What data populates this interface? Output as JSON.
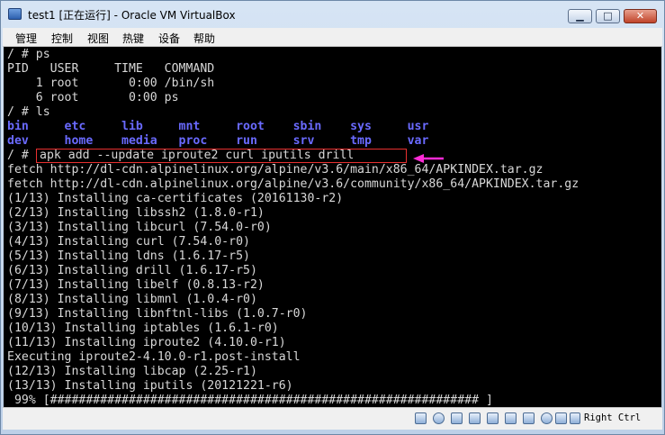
{
  "window": {
    "title": "test1 [正在运行] - Oracle VM VirtualBox"
  },
  "titlebar_buttons": {
    "minimize": "▁",
    "maximize": "□",
    "close": "✕"
  },
  "menu": [
    "管理",
    "控制",
    "视图",
    "热键",
    "设备",
    "帮助"
  ],
  "terminal": {
    "lines": [
      "/ # ps",
      "PID   USER     TIME   COMMAND",
      "    1 root       0:00 /bin/sh",
      "    6 root       0:00 ps",
      "/ # ls",
      "",
      "",
      "/ # ",
      "fetch http://dl-cdn.alpinelinux.org/alpine/v3.6/main/x86_64/APKINDEX.tar.gz",
      "fetch http://dl-cdn.alpinelinux.org/alpine/v3.6/community/x86_64/APKINDEX.tar.gz",
      "(1/13) Installing ca-certificates (20161130-r2)",
      "(2/13) Installing libssh2 (1.8.0-r1)",
      "(3/13) Installing libcurl (7.54.0-r0)",
      "(4/13) Installing curl (7.54.0-r0)",
      "(5/13) Installing ldns (1.6.17-r5)",
      "(6/13) Installing drill (1.6.17-r5)",
      "(7/13) Installing libelf (0.8.13-r2)",
      "(8/13) Installing libmnl (1.0.4-r0)",
      "(9/13) Installing libnftnl-libs (1.0.7-r0)",
      "(10/13) Installing iptables (1.6.1-r0)",
      "(11/13) Installing iproute2 (4.10.0-r1)",
      "Executing iproute2-4.10.0-r1.post-install",
      "(12/13) Installing libcap (2.25-r1)",
      "(13/13) Installing iputils (20121221-r6)",
      " 99% [############################################################ ]"
    ],
    "ls_row1": "bin     etc     lib     mnt     root    sbin    sys     usr",
    "ls_row2": "dev     home    media   proc    run     srv     tmp     var",
    "highlighted_command": "apk add --update iproute2 curl iputils drill",
    "highlight_color": "#e83030",
    "arrow_color": "#ff2bd6",
    "dir_color": "#6a6aff"
  },
  "status": {
    "icons": [
      "hard-disk-icon",
      "optical-drive-icon",
      "network-icon",
      "usb-icon",
      "shared-folder-icon",
      "display-icon",
      "video-capture-icon",
      "recording-icon",
      "mouse-integration-icon",
      "keyboard-capture-icon"
    ],
    "host_key": "Right Ctrl"
  }
}
